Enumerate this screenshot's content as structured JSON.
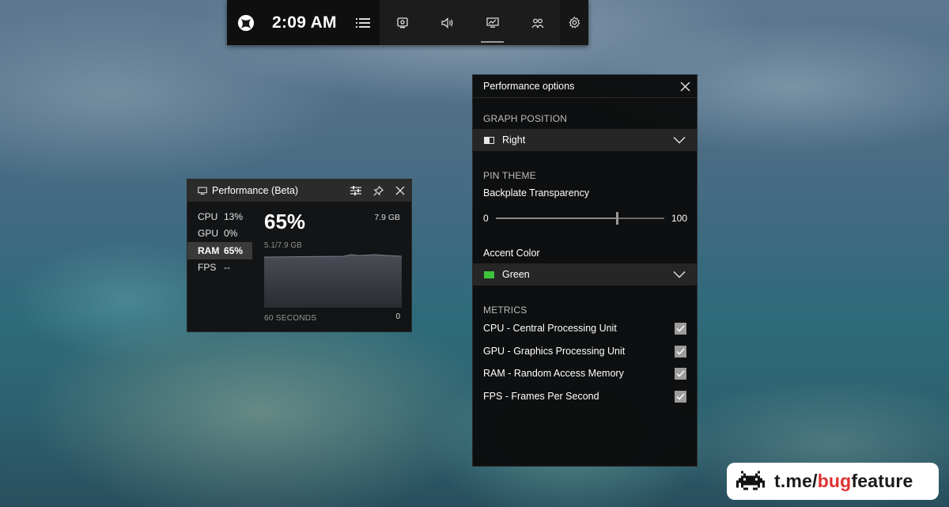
{
  "gamebar": {
    "time": "2:09 AM",
    "widgets": [
      {
        "icon": "capture-icon",
        "active": false
      },
      {
        "icon": "audio-icon",
        "active": false
      },
      {
        "icon": "performance-icon",
        "active": true
      },
      {
        "icon": "xbox-social-icon",
        "active": false
      }
    ],
    "settings_icon": "gear-icon"
  },
  "performance_widget": {
    "title": "Performance (Beta)",
    "metrics": [
      {
        "name": "CPU",
        "value": "13%",
        "selected": false
      },
      {
        "name": "GPU",
        "value": "0%",
        "selected": false
      },
      {
        "name": "RAM",
        "value": "65%",
        "selected": true
      },
      {
        "name": "FPS",
        "value": "--",
        "selected": false
      }
    ],
    "big_value": "65%",
    "total": "7.9 GB",
    "used": "5.1/7.9 GB",
    "x_label": "60 SECONDS",
    "min_label": "0"
  },
  "performance_options": {
    "title": "Performance options",
    "graph_position": {
      "section": "GRAPH POSITION",
      "value": "Right"
    },
    "pin_theme": {
      "section": "PIN THEME",
      "transparency_label": "Backplate Transparency",
      "slider_min": "0",
      "slider_max": "100",
      "slider_value_fraction": 0.72
    },
    "accent_color": {
      "label": "Accent Color",
      "value": "Green",
      "swatch": "#3cc43c"
    },
    "metrics": {
      "section": "METRICS",
      "items": [
        {
          "label": "CPU - Central Processing Unit",
          "checked": true
        },
        {
          "label": "GPU - Graphics Processing Unit",
          "checked": true
        },
        {
          "label": "RAM - Random Access Memory",
          "checked": true
        },
        {
          "label": "FPS - Frames Per Second",
          "checked": true
        }
      ]
    }
  },
  "watermark": {
    "prefix": "t.me/",
    "highlight": "bug",
    "suffix": "feature",
    "highlight_color": "#e03131"
  }
}
